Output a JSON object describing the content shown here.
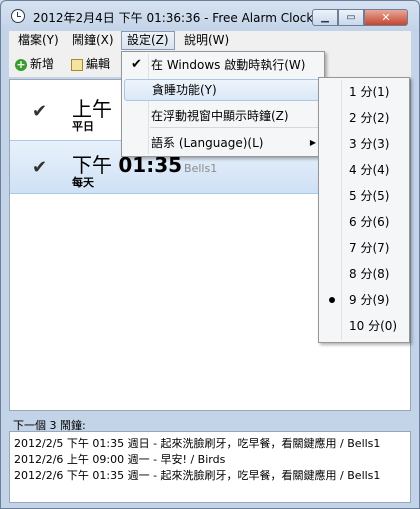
{
  "window": {
    "title": "2012年2月4日 下午 01:36:36 - Free Alarm Clock",
    "minimize_glyph": "▁",
    "maximize_glyph": "▭",
    "close_glyph": "✕"
  },
  "menubar": {
    "items": [
      {
        "label": "檔案(Y)"
      },
      {
        "label": "鬧鐘(X)"
      },
      {
        "label": "設定(Z)"
      },
      {
        "label": "說明(W)"
      }
    ]
  },
  "toolbar": {
    "add_label": "新增",
    "edit_label": "編輯"
  },
  "alarms": [
    {
      "checked": true,
      "period": "上午",
      "time": "",
      "sound": "",
      "days": "平日"
    },
    {
      "checked": true,
      "period": "下午",
      "time": "01:35",
      "sound": "Bells1",
      "days": "每天"
    }
  ],
  "check_glyph": "✔",
  "next": {
    "label": "下一個 3 鬧鐘:",
    "lines": [
      "2012/2/5 下午 01:35 週日 - 起來洗臉刷牙，吃早餐，看關鍵應用 / Bells1",
      "2012/2/6 上午 09:00 週一 - 早安! / Birds",
      "2012/2/6 下午 01:35 週一 - 起來洗臉刷牙，吃早餐，看關鍵應用 / Bells1"
    ]
  },
  "settings_menu": {
    "items": [
      {
        "label": "在 Windows 啟動時執行(W)",
        "checked": true
      },
      {
        "label": "貪睡功能(Y)",
        "highlighted": true
      },
      {
        "label": "在浮動視窗中顯示時鐘(Z)"
      },
      {
        "label": "語系 (Language)(L)",
        "has_submenu": true
      }
    ],
    "submenu_arrow": "▶"
  },
  "snooze_submenu": {
    "items": [
      {
        "label": "1 分(1)"
      },
      {
        "label": "2 分(2)"
      },
      {
        "label": "3 分(3)"
      },
      {
        "label": "4 分(4)"
      },
      {
        "label": "5 分(5)"
      },
      {
        "label": "6 分(6)"
      },
      {
        "label": "7 分(7)"
      },
      {
        "label": "8 分(8)"
      },
      {
        "label": "9 分(9)",
        "selected": true
      },
      {
        "label": "10 分(0)"
      }
    ]
  }
}
